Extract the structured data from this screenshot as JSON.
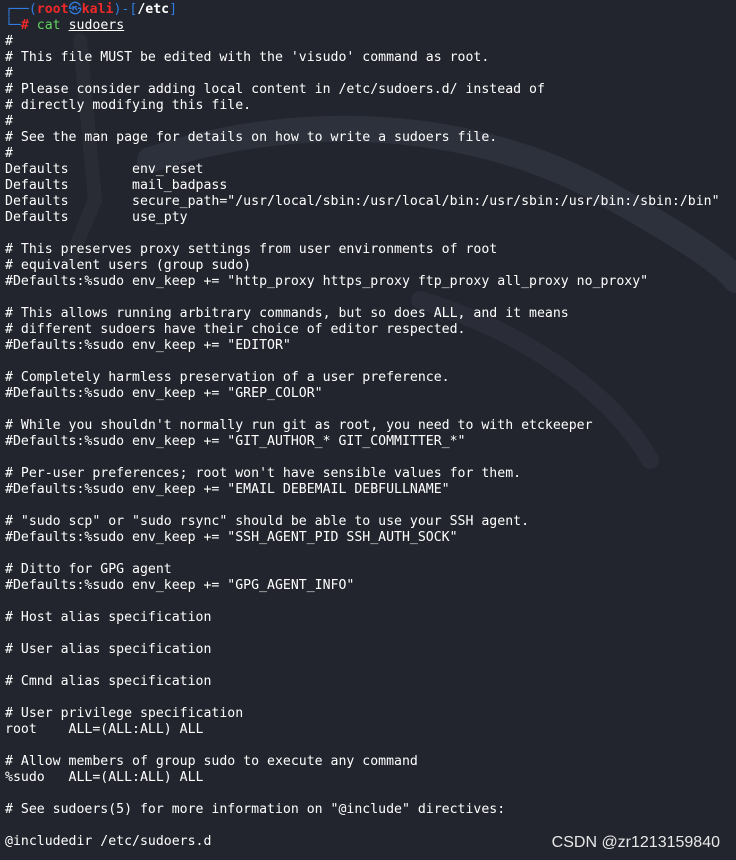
{
  "prompt": {
    "box_top_left": "┌──(",
    "user": "root",
    "skull": "㉿",
    "host": "kali",
    "close_paren": ")-[",
    "cwd": "/etc",
    "close_bracket": "]",
    "box_bottom_left": "└─",
    "symbol": "#",
    "command": "cat",
    "argument": "sudoers"
  },
  "file_lines": [
    "#",
    "# This file MUST be edited with the 'visudo' command as root.",
    "#",
    "# Please consider adding local content in /etc/sudoers.d/ instead of",
    "# directly modifying this file.",
    "#",
    "# See the man page for details on how to write a sudoers file.",
    "#",
    "Defaults        env_reset",
    "Defaults        mail_badpass",
    "Defaults        secure_path=\"/usr/local/sbin:/usr/local/bin:/usr/sbin:/usr/bin:/sbin:/bin\"",
    "Defaults        use_pty",
    "",
    "# This preserves proxy settings from user environments of root",
    "# equivalent users (group sudo)",
    "#Defaults:%sudo env_keep += \"http_proxy https_proxy ftp_proxy all_proxy no_proxy\"",
    "",
    "# This allows running arbitrary commands, but so does ALL, and it means",
    "# different sudoers have their choice of editor respected.",
    "#Defaults:%sudo env_keep += \"EDITOR\"",
    "",
    "# Completely harmless preservation of a user preference.",
    "#Defaults:%sudo env_keep += \"GREP_COLOR\"",
    "",
    "# While you shouldn't normally run git as root, you need to with etckeeper",
    "#Defaults:%sudo env_keep += \"GIT_AUTHOR_* GIT_COMMITTER_*\"",
    "",
    "# Per-user preferences; root won't have sensible values for them.",
    "#Defaults:%sudo env_keep += \"EMAIL DEBEMAIL DEBFULLNAME\"",
    "",
    "# \"sudo scp\" or \"sudo rsync\" should be able to use your SSH agent.",
    "#Defaults:%sudo env_keep += \"SSH_AGENT_PID SSH_AUTH_SOCK\"",
    "",
    "# Ditto for GPG agent",
    "#Defaults:%sudo env_keep += \"GPG_AGENT_INFO\"",
    "",
    "# Host alias specification",
    "",
    "# User alias specification",
    "",
    "# Cmnd alias specification",
    "",
    "# User privilege specification",
    "root    ALL=(ALL:ALL) ALL",
    "",
    "# Allow members of group sudo to execute any command",
    "%sudo   ALL=(ALL:ALL) ALL",
    "",
    "# See sudoers(5) for more information on \"@include\" directives:",
    "",
    "@includedir /etc/sudoers.d"
  ],
  "watermark": "CSDN @zr1213159840",
  "colors": {
    "background": "#23252e",
    "prompt_box": "#2f7de1",
    "prompt_user": "#ef2929",
    "command_name": "#5fd75f",
    "text": "#ffffff"
  }
}
